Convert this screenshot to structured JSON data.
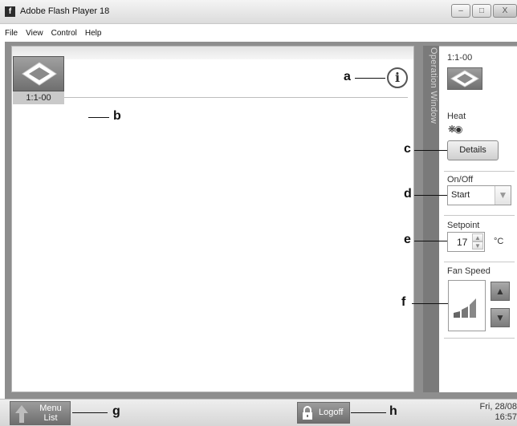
{
  "window": {
    "title": "Adobe Flash Player 18",
    "app_icon": "flash-icon",
    "controls": [
      "minimize-icon",
      "maximize-icon",
      "close-icon"
    ]
  },
  "menu": [
    "File",
    "View",
    "Control",
    "Help"
  ],
  "main": {
    "info_icon": "info-icon",
    "info_glyph": "i",
    "unit": {
      "icon": "indoor-unit-icon",
      "label": "1:1-00"
    }
  },
  "operation_window": {
    "side_label": "Operation Window",
    "unit_label": "1:1-00",
    "unit_icon": "indoor-unit-icon",
    "mode_label": "Heat",
    "mode_icon": "heat-mode-icon",
    "details_label": "Details",
    "onoff_label": "On/Off",
    "onoff_value": "Start",
    "setpoint_label": "Setpoint",
    "setpoint_value": "17",
    "setpoint_unit": "°C",
    "fan_speed_label": "Fan Speed",
    "fan_icon": "fan-speed-bars-icon"
  },
  "callouts": [
    "a",
    "b",
    "c",
    "d",
    "e",
    "f",
    "g",
    "h"
  ],
  "bottom_bar": {
    "menu_list_label_1": "Menu",
    "menu_list_label_2": "List",
    "menu_list_icon": "home-arrow-icon",
    "logoff_label": "Logoff",
    "logoff_icon": "lock-icon",
    "date": "Fri, 28/08",
    "time": "16:57"
  },
  "colors": {
    "frame": "#8e8e8e",
    "side_strip": "#7a7a7a",
    "button_dark": "#7a7a7a"
  }
}
